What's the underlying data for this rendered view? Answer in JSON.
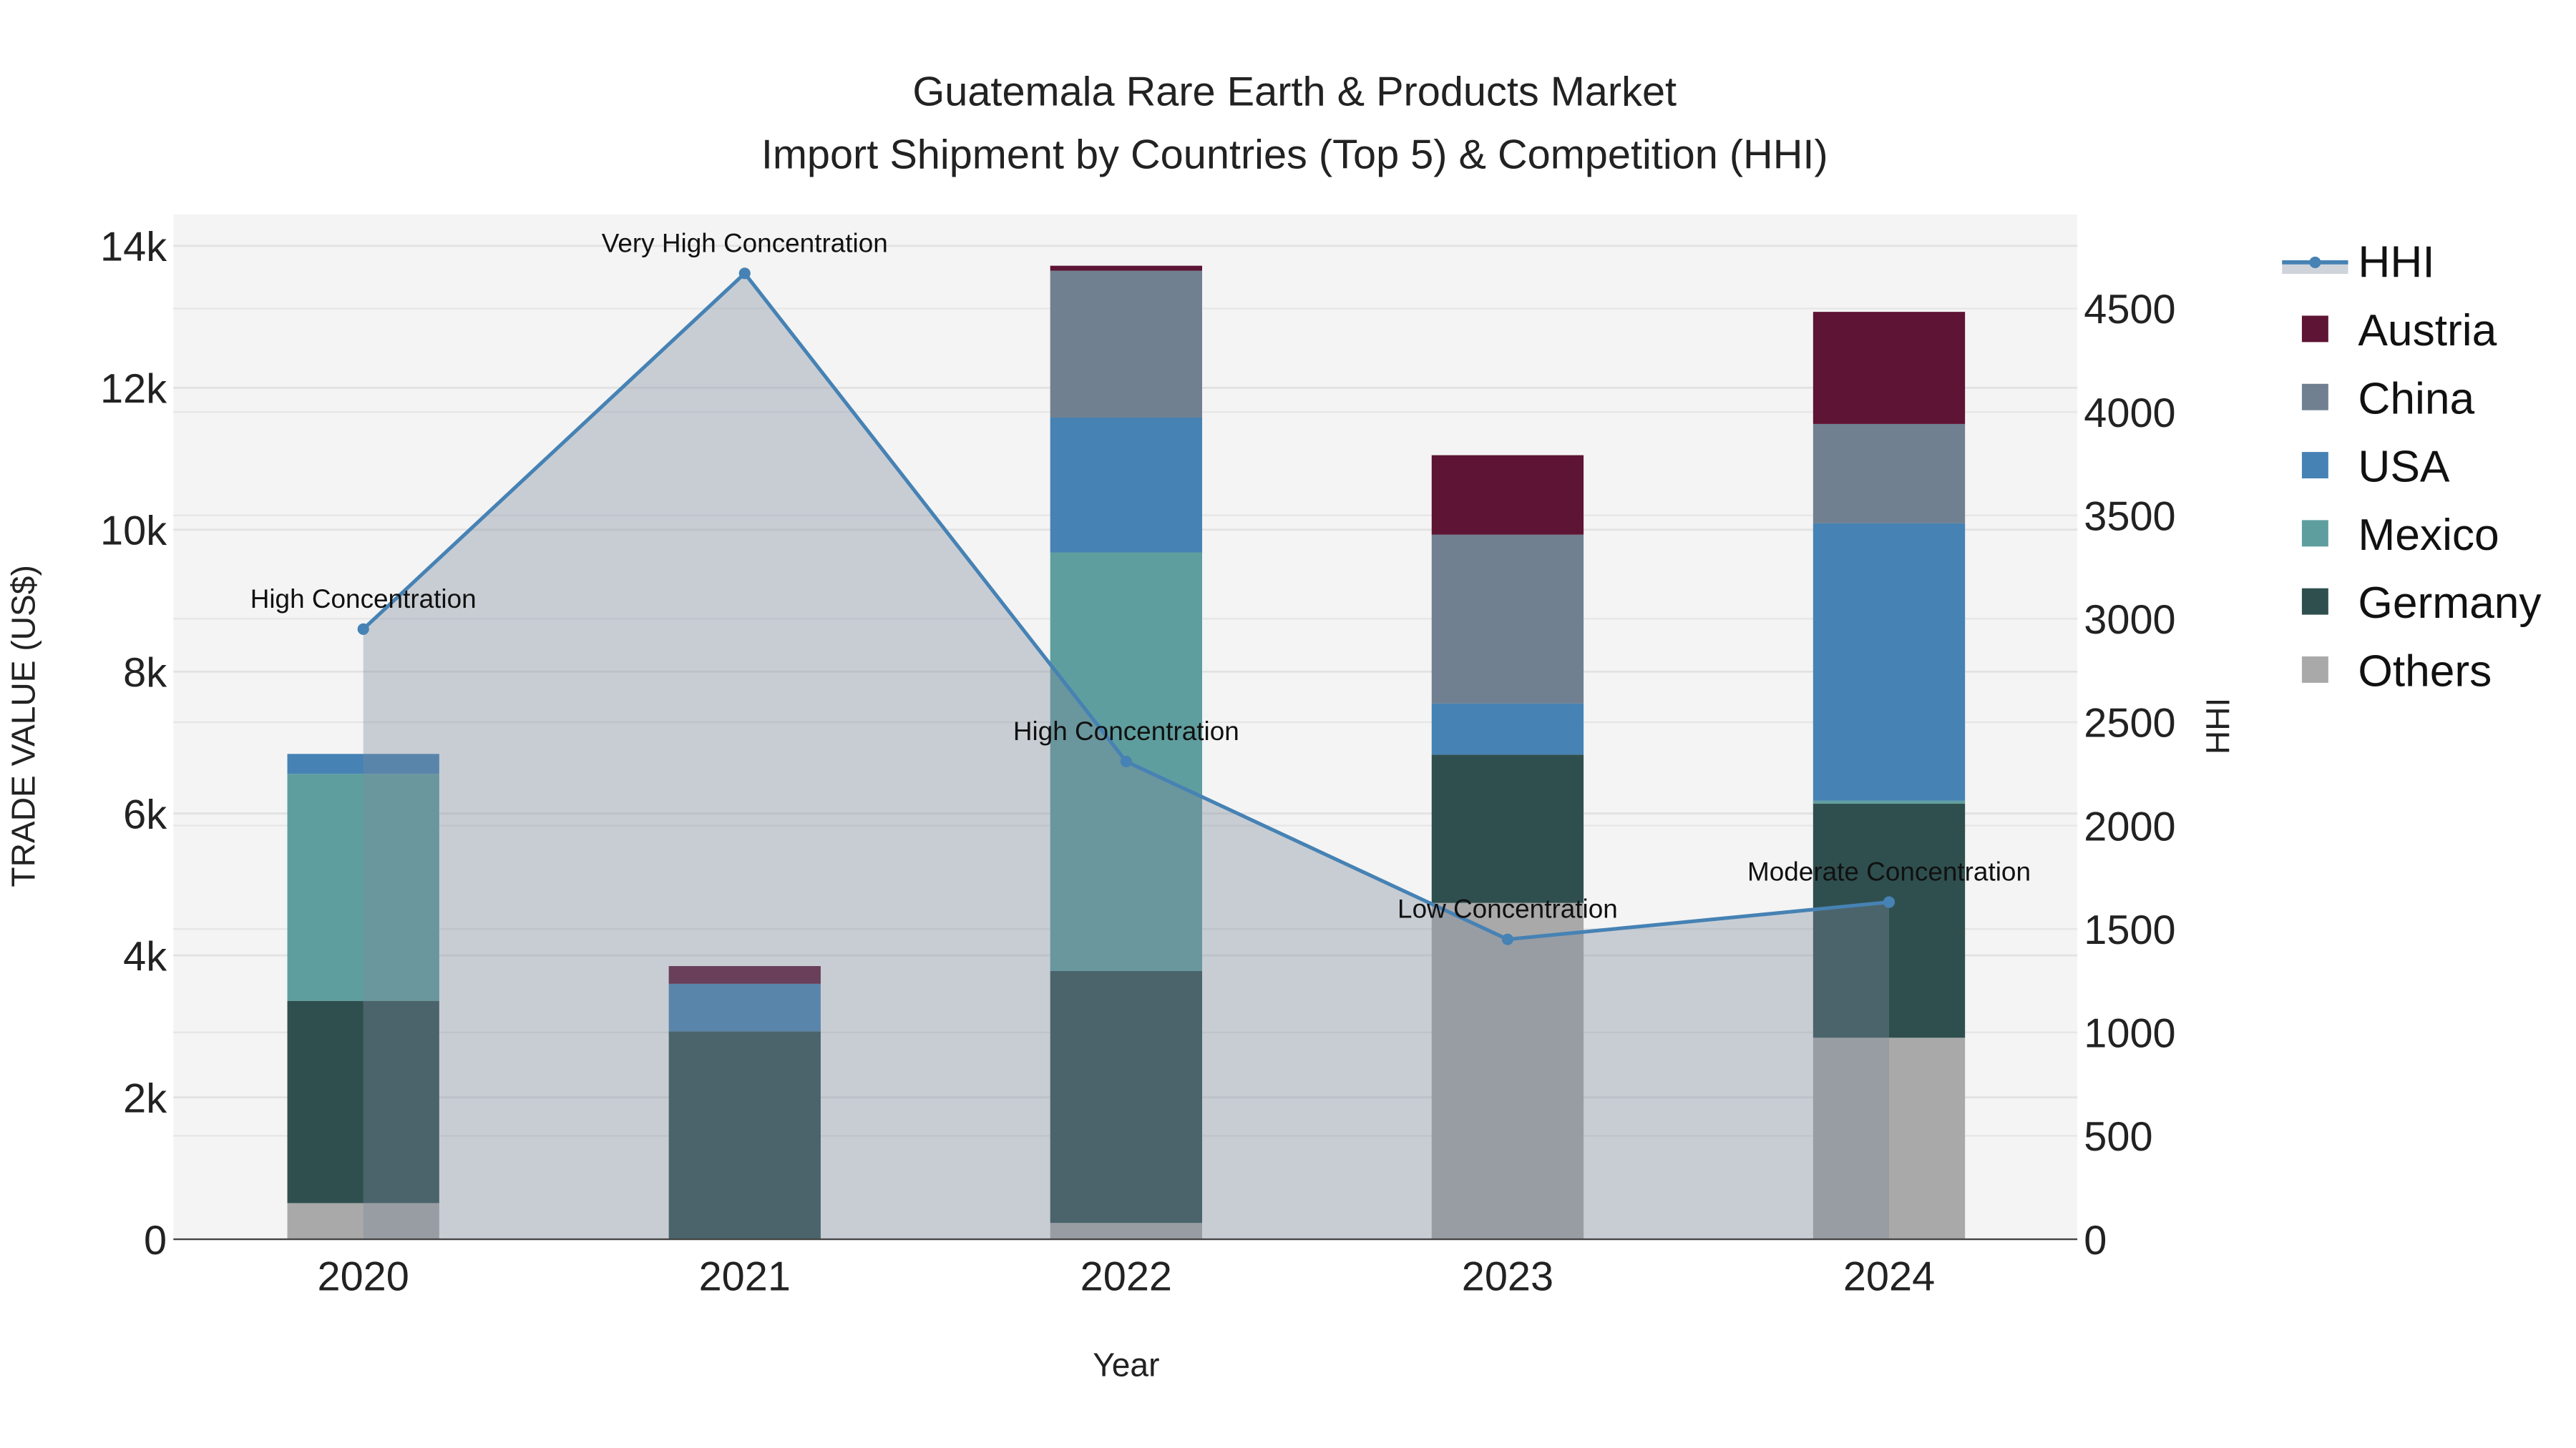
{
  "chart_data": {
    "type": "bar",
    "stacked": true,
    "title": "Guatemala Rare Earth & Products Market",
    "subtitle": "Import Shipment by Countries (Top 5) & Competition (HHI)",
    "xlabel": "Year",
    "ylabel": "TRADE VALUE (US$)",
    "y2label": "HHI",
    "categories": [
      "2020",
      "2021",
      "2022",
      "2023",
      "2024"
    ],
    "ylim": [
      0,
      14400
    ],
    "y2lim": [
      0,
      4950
    ],
    "yticks": [
      0,
      2000,
      4000,
      6000,
      8000,
      10000,
      12000,
      14000
    ],
    "ytick_labels": [
      "0",
      "2k",
      "4k",
      "6k",
      "8k",
      "10k",
      "12k",
      "14k"
    ],
    "y2ticks": [
      0,
      500,
      1000,
      1500,
      2000,
      2500,
      3000,
      3500,
      4000,
      4500
    ],
    "y2tick_labels": [
      "0",
      "500",
      "1000",
      "1500",
      "2000",
      "2500",
      "3000",
      "3500",
      "4000",
      "4500"
    ],
    "grid": true,
    "legend_position": "right",
    "series": [
      {
        "name": "Others",
        "color": "#a9a9a9",
        "values": [
          510,
          0,
          230,
          4740,
          2840
        ]
      },
      {
        "name": "Germany",
        "color": "#2f4f4f",
        "values": [
          2850,
          2930,
          3550,
          2090,
          3300
        ]
      },
      {
        "name": "Mexico",
        "color": "#5f9e9e",
        "values": [
          3200,
          0,
          5900,
          0,
          40
        ]
      },
      {
        "name": "USA",
        "color": "#4682b4",
        "values": [
          280,
          670,
          1900,
          720,
          3910
        ]
      },
      {
        "name": "China",
        "color": "#708090",
        "values": [
          0,
          0,
          2070,
          2380,
          1400
        ]
      },
      {
        "name": "Austria",
        "color": "#5e1434",
        "values": [
          0,
          250,
          70,
          1120,
          1580
        ]
      }
    ],
    "hhi": {
      "name": "HHI",
      "color": "#4682b4",
      "values": [
        2950,
        4670,
        2310,
        1450,
        1630
      ],
      "annotations": [
        "High Concentration",
        "Very High Concentration",
        "High Concentration",
        "Low Concentration",
        "Moderate Concentration"
      ]
    },
    "legend_order": [
      "HHI",
      "Austria",
      "China",
      "USA",
      "Mexico",
      "Germany",
      "Others"
    ]
  }
}
